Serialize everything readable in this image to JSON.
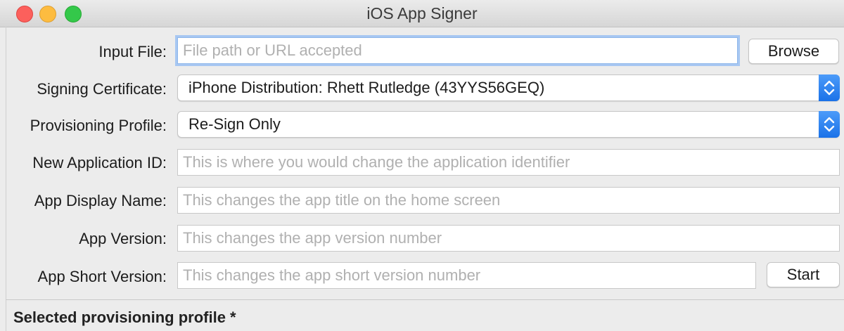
{
  "window": {
    "title": "iOS App Signer"
  },
  "form": {
    "input_file": {
      "label": "Input File:",
      "placeholder": "File path or URL accepted",
      "value": ""
    },
    "browse_button": "Browse",
    "signing_certificate": {
      "label": "Signing Certificate:",
      "selected": "iPhone Distribution: Rhett Rutledge (43YYS56GEQ)"
    },
    "provisioning_profile": {
      "label": "Provisioning Profile:",
      "selected": "Re-Sign Only"
    },
    "new_application_id": {
      "label": "New Application ID:",
      "placeholder": "This is where you would change the application identifier"
    },
    "app_display_name": {
      "label": "App Display Name:",
      "placeholder": "This changes the app title on the home screen"
    },
    "app_version": {
      "label": "App Version:",
      "placeholder": "This changes the app version number"
    },
    "app_short_version": {
      "label": "App Short Version:",
      "placeholder": "This changes the app short version number"
    },
    "start_button": "Start"
  },
  "status": {
    "text": "Selected provisioning profile *"
  },
  "colors": {
    "close": "#fc605c",
    "minimize": "#fdbc40",
    "zoom": "#34c84a",
    "focus_ring": "#a7c7f2",
    "stepper_accent": "#1b72e8"
  },
  "icons": {
    "close": "close-icon",
    "minimize": "minimize-icon",
    "zoom": "zoom-icon",
    "stepper": "chevron-up-down-icon"
  }
}
